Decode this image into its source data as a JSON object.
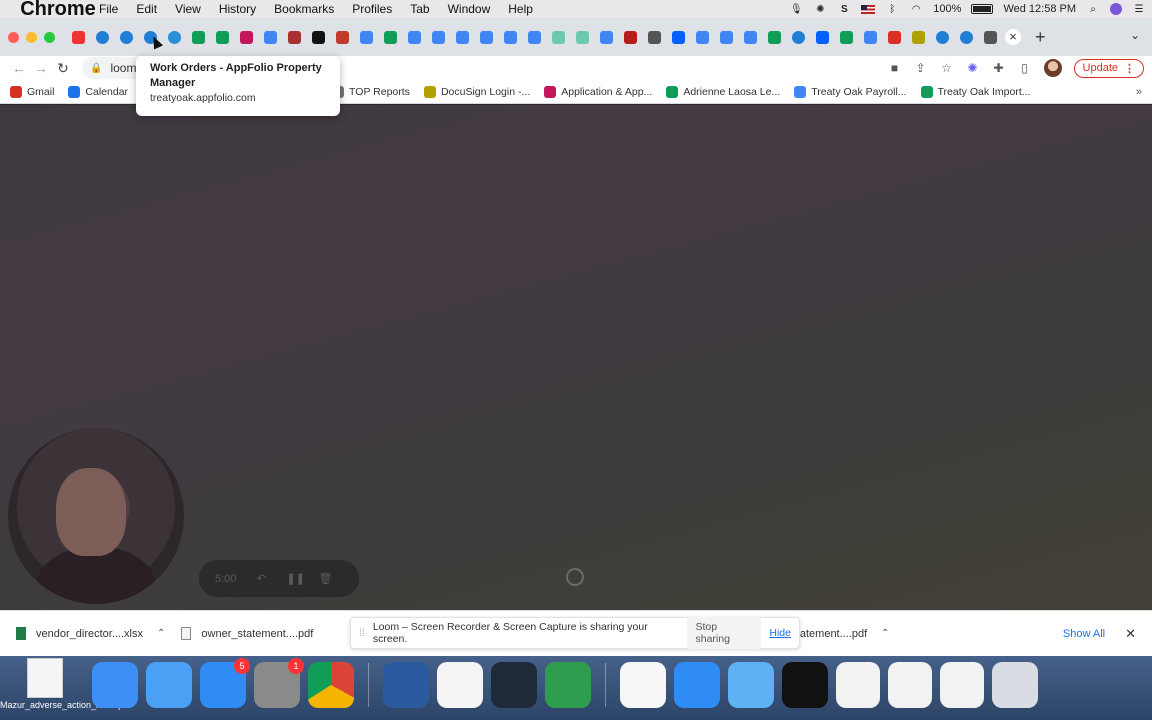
{
  "menubar": {
    "app": "Chrome",
    "items": [
      "File",
      "Edit",
      "View",
      "History",
      "Bookmarks",
      "Profiles",
      "Tab",
      "Window",
      "Help"
    ],
    "battery": "100%",
    "clock": "Wed 12:58 PM"
  },
  "tabs": {
    "favicons": [
      "record",
      "appfolio",
      "appfolio",
      "appfolio",
      "edge",
      "sheets",
      "sheets",
      "app-r",
      "docs",
      "app-r2",
      "c-black",
      "shield",
      "docs",
      "sheets",
      "docs",
      "docs",
      "docs",
      "docs",
      "docs",
      "docs",
      "owl",
      "owl",
      "docs",
      "red-arc",
      "globe",
      "dropbox",
      "docs",
      "docs",
      "docs",
      "sheets",
      "appfolio",
      "dropbox",
      "sheets",
      "docs",
      "gmail",
      "download",
      "appfolio",
      "appfolio",
      "chrome"
    ],
    "close": "×",
    "new_tab": "+",
    "menu": "⌄"
  },
  "toolbar": {
    "url": "loom",
    "update_label": "Update"
  },
  "tooltip": {
    "title": "Work Orders - AppFolio Property Manager",
    "url": "treatyoak.appfolio.com"
  },
  "bookmarks": [
    {
      "label": "Gmail",
      "icon": "gmail",
      "color": "#d93025"
    },
    {
      "label": "Calendar",
      "icon": "calendar",
      "color": "#1a73e8"
    },
    {
      "label": "TOP Reports",
      "icon": "folder",
      "color": "#777777"
    },
    {
      "label": "DocuSign Login -...",
      "icon": "download",
      "color": "#b0a000"
    },
    {
      "label": "Application & App...",
      "icon": "app",
      "color": "#c2185b"
    },
    {
      "label": "Adrienne Laosa Le...",
      "icon": "sheets",
      "color": "#0f9d58"
    },
    {
      "label": "Treaty Oak Payroll...",
      "icon": "docs",
      "color": "#4285f4"
    },
    {
      "label": "Treaty Oak Import...",
      "icon": "sheets",
      "color": "#0f9d58"
    }
  ],
  "recorder": {
    "time": "5:00"
  },
  "downloads": {
    "items": [
      {
        "name": "vendor_director....xlsx",
        "type": "xlsx"
      },
      {
        "name": "owner_statement....pdf",
        "type": "pdf"
      },
      {
        "name": "ner_statement....pdf",
        "type": "pdf"
      }
    ],
    "share_notice": "Loom – Screen Recorder & Screen Capture is sharing your screen.",
    "stop_sharing": "Stop sharing",
    "hide": "Hide",
    "show_all": "Show All"
  },
  "desktop": {
    "file_label": "Mazur_adverse_action_letter.pdf"
  },
  "dock": {
    "apps": [
      {
        "name": "finder",
        "color": "#3d8ff7",
        "badge": ""
      },
      {
        "name": "messages",
        "color": "#49a0f5",
        "badge": ""
      },
      {
        "name": "app-store",
        "color": "#2f8cf5",
        "badge": "5"
      },
      {
        "name": "system-preferences",
        "color": "#8a8a8a",
        "badge": "1"
      },
      {
        "name": "chrome",
        "color": "#ffffff",
        "badge": ""
      },
      {
        "name": "quicktime",
        "color": "#2c5aa0",
        "badge": ""
      },
      {
        "name": "preview",
        "color": "#f4f4f4",
        "badge": ""
      },
      {
        "name": "webex",
        "color": "#1e2a38",
        "badge": ""
      },
      {
        "name": "numbers",
        "color": "#2f9d4e",
        "badge": ""
      },
      {
        "name": "textedit",
        "color": "#f7f7f7",
        "badge": ""
      },
      {
        "name": "app-store-2",
        "color": "#2f8cf5",
        "badge": ""
      },
      {
        "name": "folder",
        "color": "#5eb1f3",
        "badge": ""
      },
      {
        "name": "terminal",
        "color": "#111111",
        "badge": ""
      },
      {
        "name": "doc-thumb-1",
        "color": "#f2f2f2",
        "badge": ""
      },
      {
        "name": "doc-thumb-2",
        "color": "#f2f2f2",
        "badge": ""
      },
      {
        "name": "doc-thumb-3",
        "color": "#f2f2f2",
        "badge": ""
      },
      {
        "name": "trash",
        "color": "#d9dde3",
        "badge": ""
      }
    ]
  }
}
